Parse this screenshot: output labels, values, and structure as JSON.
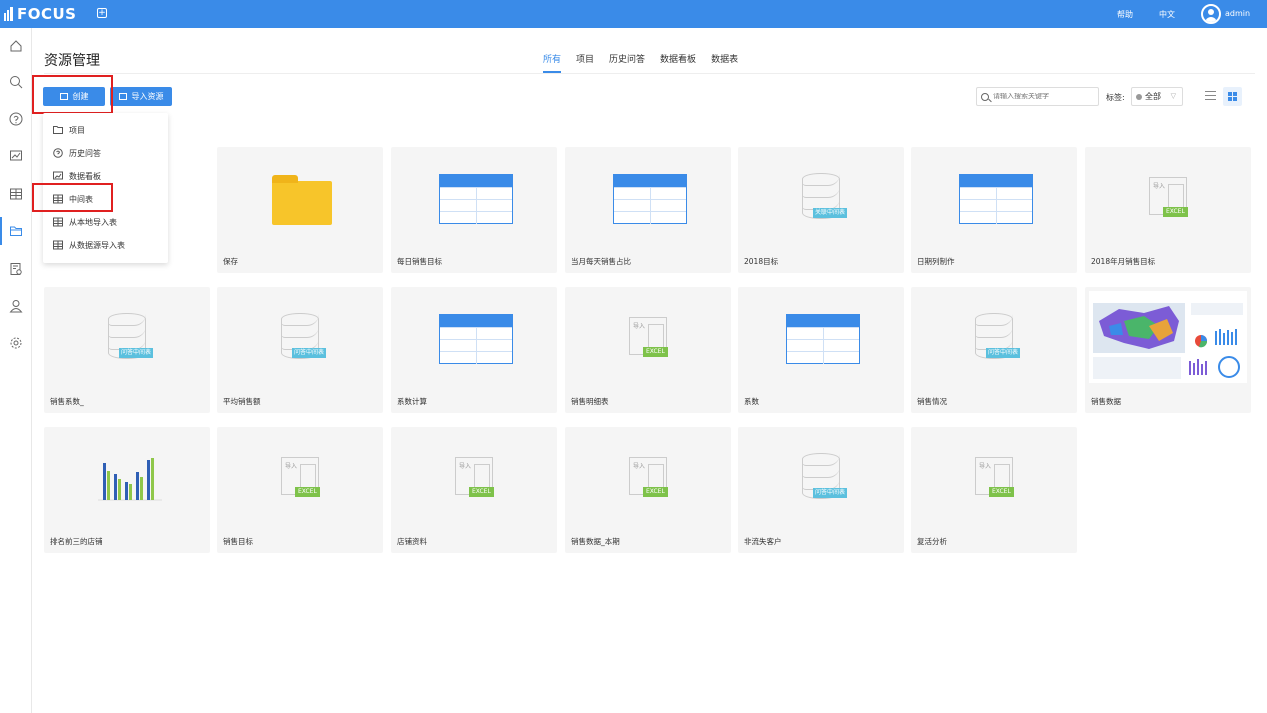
{
  "topbar": {
    "logo_text": "FOCUS",
    "new_tab": "+",
    "help": "帮助",
    "language": "中文",
    "user": "admin"
  },
  "page": {
    "title": "资源管理"
  },
  "tabs": [
    "所有",
    "项目",
    "历史问答",
    "数据看板",
    "数据表"
  ],
  "toolbar": {
    "create_label": "创建",
    "import_label": "导入资源",
    "search_placeholder": "请输入搜索关键字",
    "tag_label": "标签:",
    "tag_value": "全部"
  },
  "dropdown": [
    {
      "label": "项目",
      "icon": "folder-icon"
    },
    {
      "label": "历史问答",
      "icon": "question-icon"
    },
    {
      "label": "数据看板",
      "icon": "dashboard-icon"
    },
    {
      "label": "中间表",
      "icon": "table-icon"
    },
    {
      "label": "从本地导入表",
      "icon": "table-icon"
    },
    {
      "label": "从数据源导入表",
      "icon": "table-icon"
    }
  ],
  "cards": [
    {
      "name": "保存",
      "type": "folder"
    },
    {
      "name": "每日销售目标",
      "type": "table"
    },
    {
      "name": "当月每天销售占比",
      "type": "table"
    },
    {
      "name": "2018目标",
      "type": "db",
      "badge": "关联中间表"
    },
    {
      "name": "日期列制作",
      "type": "table"
    },
    {
      "name": "2018年月销售目标",
      "type": "excel"
    },
    {
      "name": "销售系数_",
      "type": "db",
      "badge": "问答中间表"
    },
    {
      "name": "平均销售额",
      "type": "db",
      "badge": "问答中间表"
    },
    {
      "name": "系数计算",
      "type": "table"
    },
    {
      "name": "销售明细表",
      "type": "excel"
    },
    {
      "name": "系数",
      "type": "table"
    },
    {
      "name": "销售情况",
      "type": "db",
      "badge": "问答中间表"
    },
    {
      "name": "销售数据",
      "type": "dashboard"
    },
    {
      "name": "排名前三的店铺",
      "type": "chart"
    },
    {
      "name": "销售目标",
      "type": "excel"
    },
    {
      "name": "店铺资料",
      "type": "excel"
    },
    {
      "name": "销售数据_本期",
      "type": "excel"
    },
    {
      "name": "非流失客户",
      "type": "db",
      "badge": "问答中间表"
    },
    {
      "name": "复活分析",
      "type": "excel"
    }
  ],
  "icons": {
    "import_badge": "导入",
    "excel_badge": "EXCEL"
  },
  "colors": {
    "primary": "#3a8be8",
    "highlight": "#e02020",
    "folder": "#f7c52a",
    "excel": "#7ec24a",
    "db_badge": "#5bc0de"
  }
}
